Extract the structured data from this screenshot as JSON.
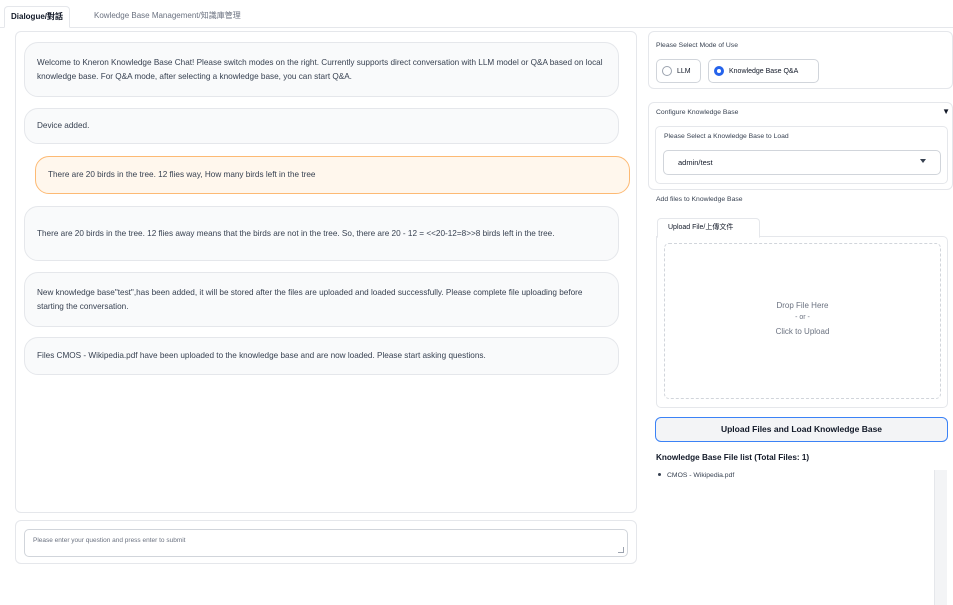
{
  "tabs": {
    "dialogue": "Dialogue/對話",
    "kb_management": "Kowledge Base Management/知識庫管理"
  },
  "chat": {
    "messages": [
      {
        "role": "bot",
        "text": "Welcome to Kneron Knowledge Base Chat! Please switch modes on the right. Currently supports direct conversation with LLM model or Q&A based on local knowledge base. For Q&A mode, after selecting a knowledge base, you can start Q&A."
      },
      {
        "role": "bot",
        "text": "Device added."
      },
      {
        "role": "user",
        "text": "There are 20 birds in the tree. 12 flies way, How many birds left in the tree"
      },
      {
        "role": "bot",
        "text": "There are 20 birds in the tree. 12 flies away means that the birds are not in the tree. So, there are 20 - 12 = <<20-12=8>>8 birds left in the tree."
      },
      {
        "role": "bot",
        "text": "New knowledge base\"test\",has been added, it will be stored after the files are uploaded and loaded successfully. Please complete file uploading before starting the conversation."
      },
      {
        "role": "bot",
        "text": "Files CMOS - Wikipedia.pdf have been uploaded to the knowledge base and are now loaded. Please start asking questions."
      }
    ],
    "input_placeholder": "Please enter your question and press enter to submit"
  },
  "mode": {
    "label": "Please Select Mode of Use",
    "options": [
      "LLM",
      "Knowledge Base Q&A"
    ],
    "selected": "Knowledge Base Q&A"
  },
  "kb": {
    "section_title": "Configure Knowledge Base",
    "select_label": "Please Select a Knowledge Base to Load",
    "selected": "admin/test",
    "add_files_label": "Add files to Knowledge Base",
    "upload_tab": "Upload File/上傳文件",
    "drop_here": "Drop File Here",
    "or": "- or -",
    "click_upload": "Click to Upload",
    "upload_button": "Upload Files and Load Knowledge Base",
    "file_list_title": "Knowledge Base File list (Total Files: 1)",
    "files": [
      "CMOS - Wikipedia.pdf"
    ]
  },
  "colors": {
    "accent": "#2563eb",
    "user_bubble_bg": "#fff7ed",
    "user_bubble_border": "#fdba74"
  }
}
